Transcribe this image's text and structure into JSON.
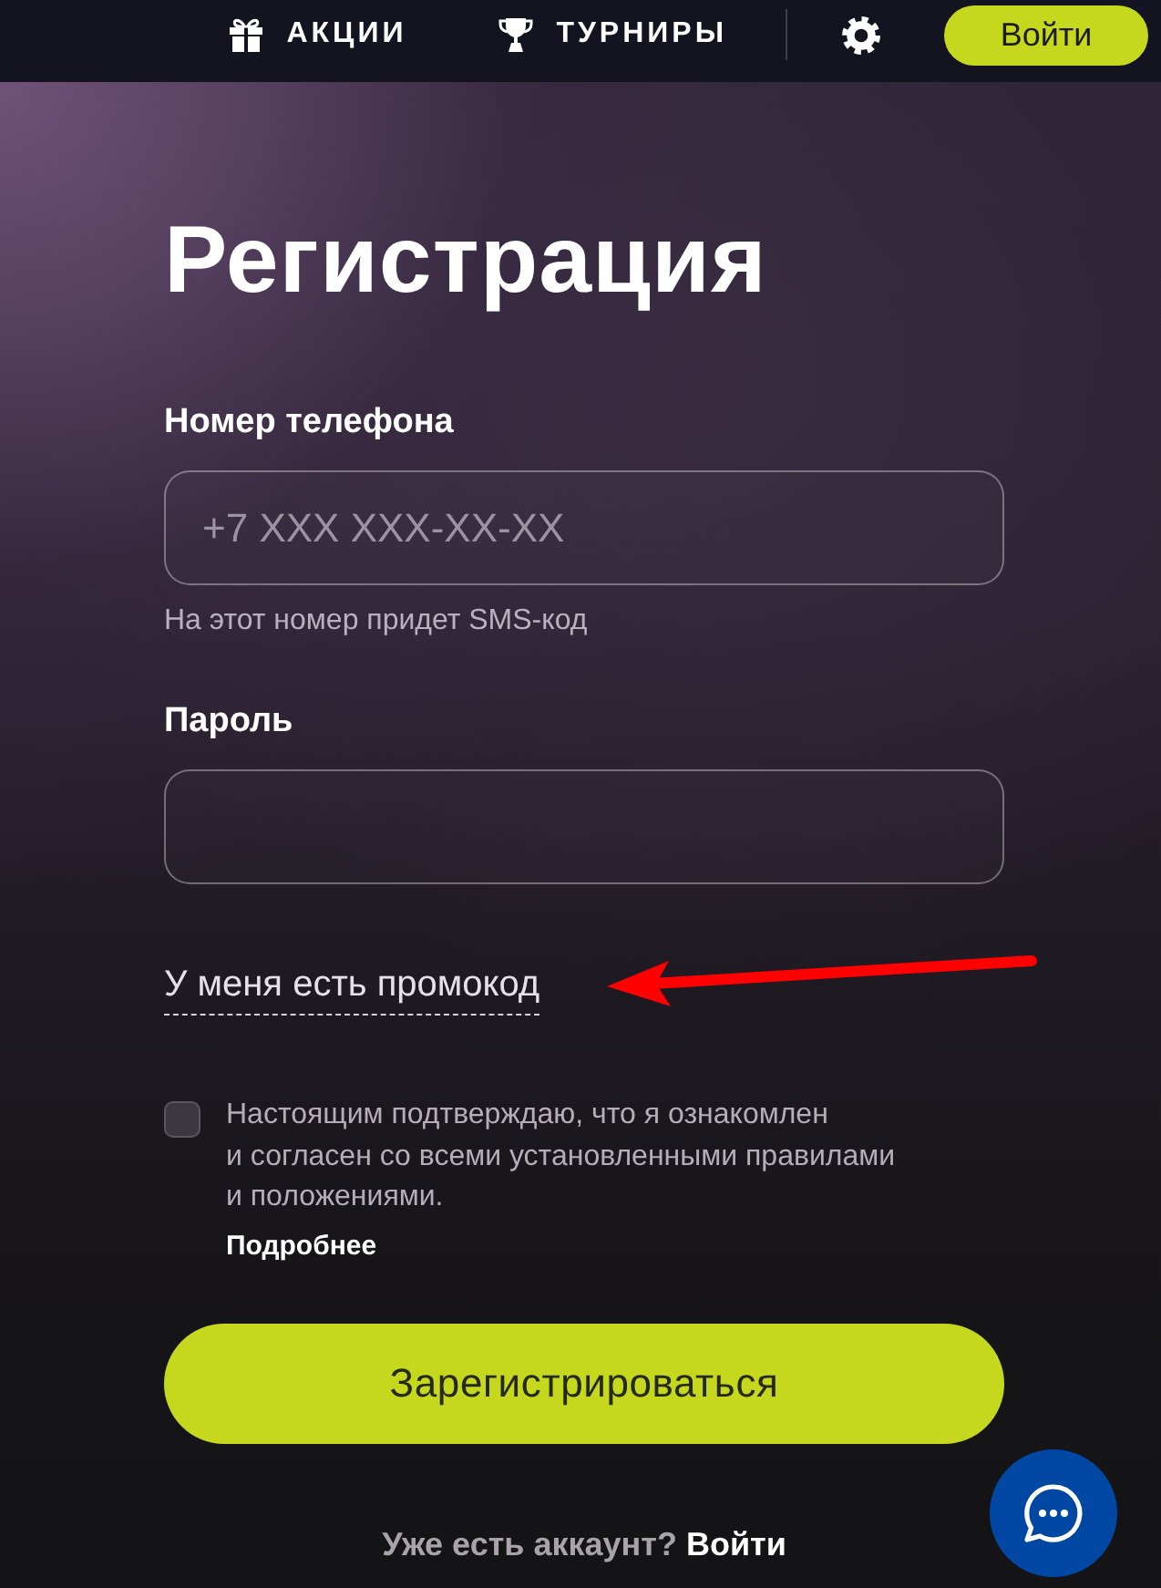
{
  "nav": {
    "items": [
      {
        "label": "АКЦИИ"
      },
      {
        "label": "ТУРНИРЫ"
      }
    ],
    "login_button": "Войти"
  },
  "form": {
    "title": "Регистрация",
    "phone": {
      "label": "Номер телефона",
      "placeholder": "+7 XXX XXX-XX-XX",
      "hint": "На этот номер придет SMS-код"
    },
    "password": {
      "label": "Пароль"
    },
    "promo_link": "У меня есть промокод",
    "consent": {
      "checked": false,
      "text": "Настоящим подтверждаю, что я ознакомлен\nи согласен со всеми установленными правилами\nи положениями.",
      "more_link": "Подробнее"
    },
    "submit": "Зарегистрироваться",
    "footer": {
      "question": "Уже есть аккаунт?",
      "link": "Войти"
    }
  }
}
